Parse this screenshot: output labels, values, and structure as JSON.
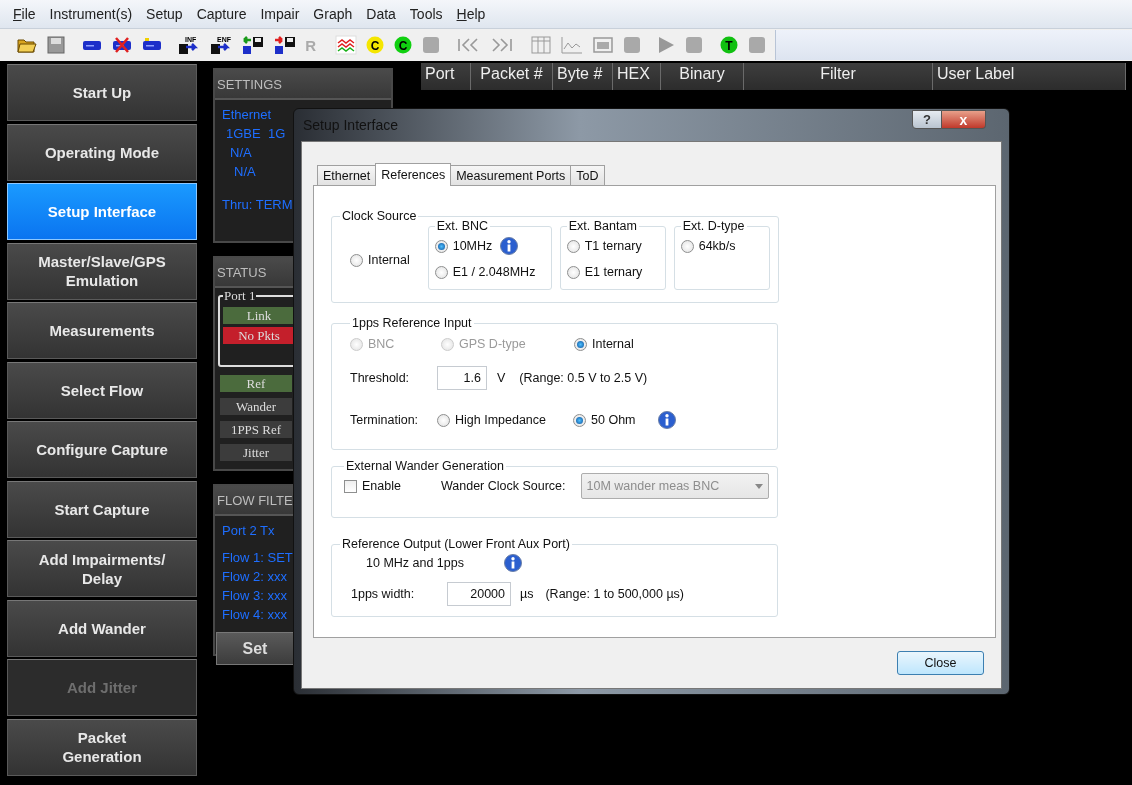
{
  "menu": [
    {
      "label": "File",
      "underlined": true
    },
    {
      "label": "Instrument(s)",
      "underlined": false
    },
    {
      "label": "Setup",
      "underlined": false
    },
    {
      "label": "Capture",
      "underlined": false
    },
    {
      "label": "Impair",
      "underlined": false
    },
    {
      "label": "Graph",
      "underlined": false
    },
    {
      "label": "Data",
      "underlined": false
    },
    {
      "label": "Tools",
      "underlined": false
    },
    {
      "label": "Help",
      "underlined": true
    }
  ],
  "toolbar": {
    "glyph_labels": [
      "INF",
      "ENF",
      "R",
      "C",
      "C",
      "T"
    ]
  },
  "nav": [
    {
      "label": "Start Up",
      "selected": false,
      "disabled": false
    },
    {
      "label": "Operating Mode",
      "selected": false,
      "disabled": false
    },
    {
      "label": "Setup Interface",
      "selected": true,
      "disabled": false
    },
    {
      "label": "Master/Slave/GPS\nEmulation",
      "selected": false,
      "disabled": false
    },
    {
      "label": "Measurements",
      "selected": false,
      "disabled": false
    },
    {
      "label": "Select Flow",
      "selected": false,
      "disabled": false
    },
    {
      "label": "Configure Capture",
      "selected": false,
      "disabled": false
    },
    {
      "label": "Start Capture",
      "selected": false,
      "disabled": false
    },
    {
      "label": "Add Impairments/\nDelay",
      "selected": false,
      "disabled": false
    },
    {
      "label": "Add Wander",
      "selected": false,
      "disabled": false
    },
    {
      "label": "Add Jitter",
      "selected": false,
      "disabled": true
    },
    {
      "label": "Packet\nGeneration",
      "selected": false,
      "disabled": false
    }
  ],
  "settings": {
    "title": "SETTINGS",
    "lines": [
      "Ethernet",
      "1GBE  1G",
      "N/A",
      "N/A",
      "Thru: TERM"
    ]
  },
  "status": {
    "title": "STATUS",
    "port": {
      "legend": "Port 1",
      "indicators": [
        {
          "label": "Link",
          "color": "#4b6b3d"
        },
        {
          "label": "No Pkts",
          "color": "#c41f2b"
        }
      ]
    },
    "indicators": [
      {
        "label": "Ref",
        "color": "#4b6b3d"
      },
      {
        "label": "Wander",
        "color": "#3c3c3c"
      },
      {
        "label": "1PPS Ref",
        "color": "#3c3c3c"
      },
      {
        "label": "Jitter",
        "color": "#3c3c3c"
      }
    ]
  },
  "flow_filter": {
    "title": "FLOW FILTE",
    "port": "Port 2 Tx",
    "flows": [
      "Flow 1: SET",
      "Flow 2: xxx",
      "Flow 3: xxx",
      "Flow 4: xxx"
    ],
    "button": "Set"
  },
  "table": {
    "columns": [
      "Port",
      "Packet #",
      "Byte #",
      "HEX",
      "Binary",
      "Filter",
      "User Label"
    ]
  },
  "dialog": {
    "title": "Setup Interface",
    "help": "?",
    "close_glyph": "x",
    "tabs": [
      {
        "label": "Ethernet",
        "selected": false
      },
      {
        "label": "References",
        "selected": true
      },
      {
        "label": "Measurement Ports",
        "selected": false
      },
      {
        "label": "ToD",
        "selected": false
      }
    ],
    "clock_source": {
      "legend": "Clock Source",
      "internal": {
        "label": "Internal",
        "selected": false
      },
      "groups": [
        {
          "legend": "Ext. BNC",
          "options": [
            {
              "label": "10MHz",
              "selected": true,
              "info": true
            },
            {
              "label": "E1 / 2.048MHz",
              "selected": false,
              "info": false
            }
          ]
        },
        {
          "legend": "Ext. Bantam",
          "options": [
            {
              "label": "T1 ternary",
              "selected": false,
              "info": false
            },
            {
              "label": "E1 ternary",
              "selected": false,
              "info": false
            }
          ]
        },
        {
          "legend": "Ext. D-type",
          "options": [
            {
              "label": "64kb/s",
              "selected": false,
              "info": false
            }
          ]
        }
      ]
    },
    "pps_input": {
      "legend": "1pps Reference Input",
      "options": [
        {
          "label": "BNC",
          "selected": false,
          "disabled": true
        },
        {
          "label": "GPS D-type",
          "selected": false,
          "disabled": true
        },
        {
          "label": "Internal",
          "selected": true,
          "disabled": false
        }
      ],
      "threshold": {
        "label": "Threshold:",
        "value": "1.6",
        "unit": "V",
        "range": "(Range: 0.5 V to 2.5 V)"
      },
      "termination": {
        "label": "Termination:",
        "options": [
          {
            "label": "High Impedance",
            "selected": false
          },
          {
            "label": "50 Ohm",
            "selected": true
          }
        ]
      }
    },
    "wander": {
      "legend": "External Wander Generation",
      "enable": {
        "label": "Enable",
        "checked": false
      },
      "source": {
        "label": "Wander Clock Source:",
        "value": "10M wander meas BNC",
        "disabled": true
      }
    },
    "ref_output": {
      "legend": "Reference Output (Lower Front Aux Port)",
      "text": "10 MHz and 1pps",
      "width": {
        "label": "1pps width:",
        "value": "20000",
        "unit": "µs",
        "range": "(Range: 1 to 500,000 µs)"
      }
    },
    "close_button": "Close"
  }
}
